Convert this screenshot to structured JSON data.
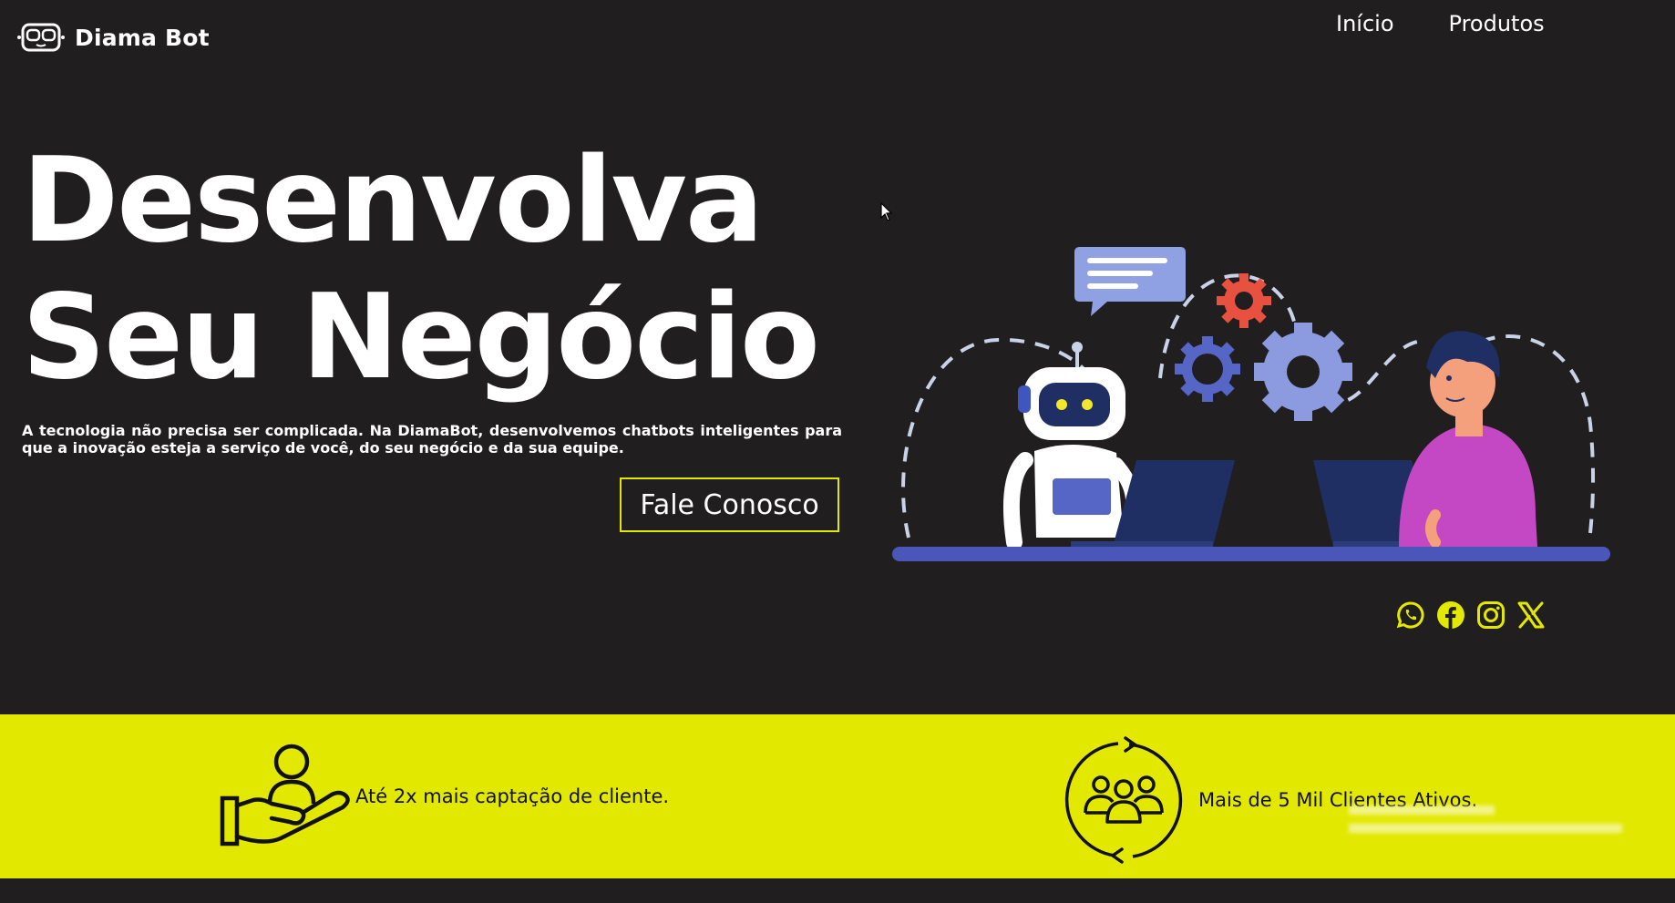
{
  "header": {
    "brand": "Diama Bot",
    "nav": [
      "Início",
      "Produtos"
    ]
  },
  "hero": {
    "title_line1": "Desenvolva",
    "title_line2": "Seu Negócio",
    "description": "A tecnologia não precisa ser complicada. Na DiamaBot, desenvolvemos chatbots inteligentes para que a inovação esteja a serviço de você, do seu negócio e da sua equipe.",
    "cta_label": "Fale Conosco"
  },
  "socials": [
    {
      "icon": "whatsapp-icon"
    },
    {
      "icon": "facebook-icon"
    },
    {
      "icon": "instagram-icon"
    },
    {
      "icon": "x-icon"
    }
  ],
  "stats": [
    {
      "icon": "hand-holding-person-icon",
      "text": "Até 2x mais captação de cliente."
    },
    {
      "icon": "group-cycle-icon",
      "text": "Mais de 5 Mil Clientes Ativos."
    }
  ],
  "colors": {
    "background": "#211e1f",
    "accent": "#e3e800",
    "text": "#ffffff"
  }
}
